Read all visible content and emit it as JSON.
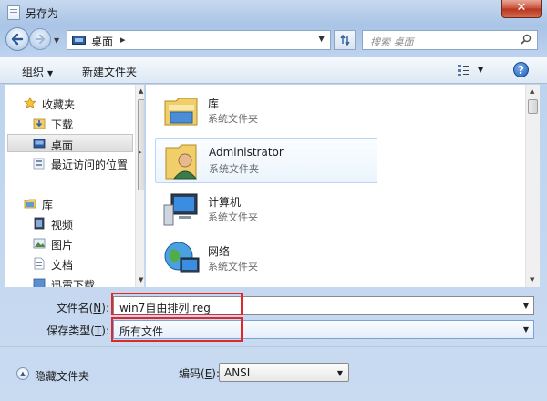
{
  "window": {
    "title": "另存为",
    "close_symbol": "✕"
  },
  "address": {
    "location": "桌面",
    "separator": "▸"
  },
  "search": {
    "placeholder": "搜索 桌面"
  },
  "toolbar": {
    "organize_label": "组织",
    "new_folder_label": "新建文件夹",
    "help_symbol": "?"
  },
  "navpane": {
    "items": [
      {
        "label": "收藏夹",
        "icon": "star-icon"
      },
      {
        "label": "下载",
        "icon": "download-folder-icon"
      },
      {
        "label": "桌面",
        "icon": "desktop-icon",
        "selected": true
      },
      {
        "label": "最近访问的位置",
        "icon": "recent-places-icon"
      },
      {
        "label": "库",
        "icon": "library-icon"
      },
      {
        "label": "视频",
        "icon": "video-icon"
      },
      {
        "label": "图片",
        "icon": "picture-icon"
      },
      {
        "label": "文档",
        "icon": "document-icon"
      },
      {
        "label": "迅雷下载",
        "icon": "thunder-download-icon"
      }
    ]
  },
  "content": {
    "items": [
      {
        "name": "库",
        "desc": "系统文件夹",
        "icon": "library-folder-icon"
      },
      {
        "name": "Administrator",
        "desc": "系统文件夹",
        "icon": "user-folder-icon",
        "hover": true
      },
      {
        "name": "计算机",
        "desc": "系统文件夹",
        "icon": "computer-icon"
      },
      {
        "name": "网络",
        "desc": "系统文件夹",
        "icon": "network-icon"
      }
    ]
  },
  "form": {
    "filename_label": "文件名(",
    "filename_key": "N",
    "filename_label_end": "):",
    "filename_value": "win7自由排列.reg",
    "filetype_label": "保存类型(",
    "filetype_key": "T",
    "filetype_label_end": "):",
    "filetype_value": "所有文件"
  },
  "footer": {
    "hide_label": "隐藏文件夹",
    "encoding_label": "编码(",
    "encoding_key": "E",
    "encoding_label_end": "):",
    "encoding_value": "ANSI"
  },
  "colors": {
    "highlight_red": "#e02828",
    "aero_blue": "#a9c4e6"
  }
}
